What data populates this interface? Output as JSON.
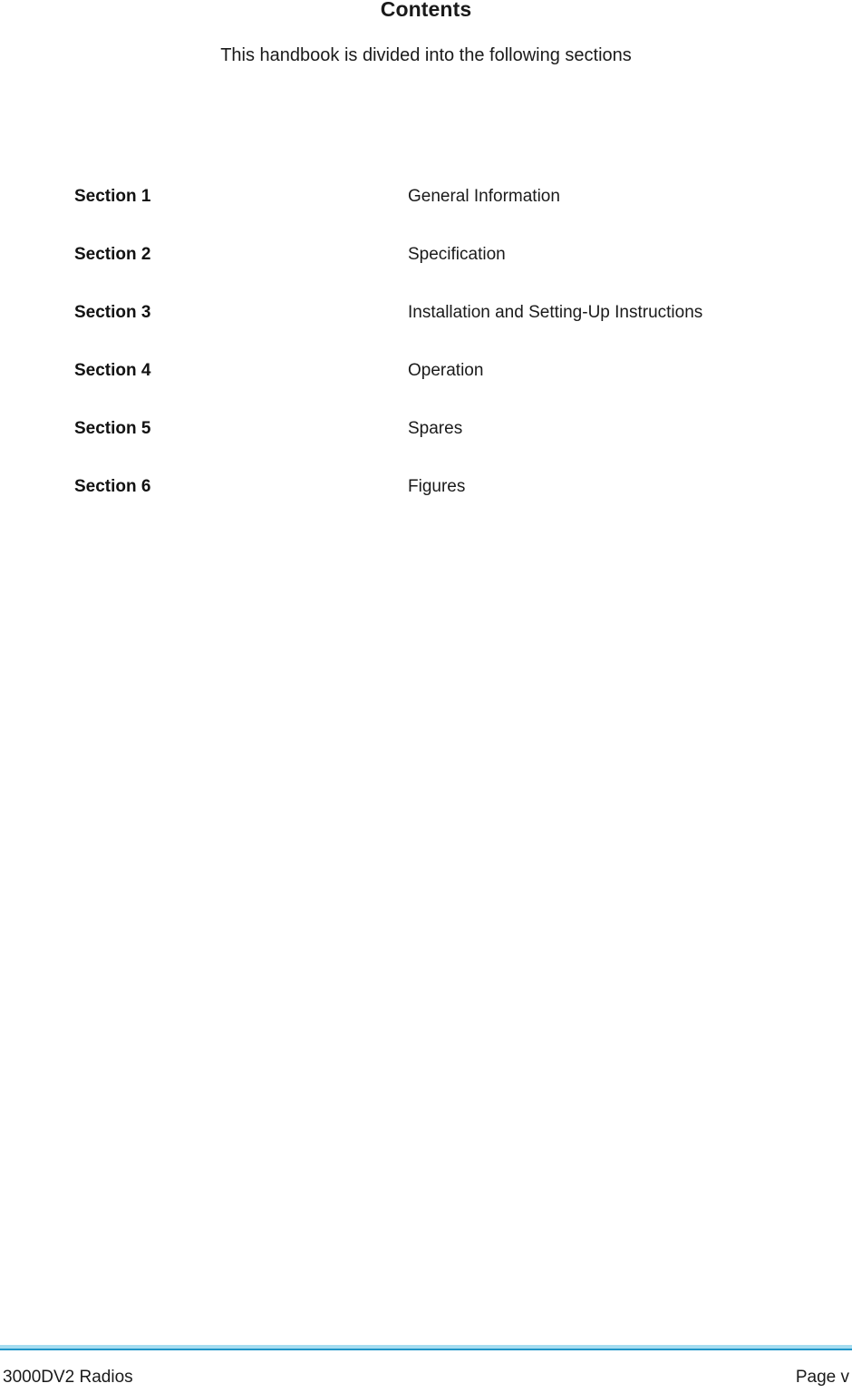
{
  "header": {
    "title": "Contents",
    "subtitle": "This handbook is divided into the following sections"
  },
  "contents": {
    "rows": [
      {
        "label": "Section 1",
        "description": "General Information"
      },
      {
        "label": "Section 2",
        "description": "Specification"
      },
      {
        "label": "Section 3",
        "description": "Installation and Setting-Up Instructions"
      },
      {
        "label": "Section 4",
        "description": "Operation"
      },
      {
        "label": "Section 5",
        "description": "Spares"
      },
      {
        "label": "Section 6",
        "description": "Figures"
      }
    ]
  },
  "footer": {
    "left": "3000DV2 Radios",
    "right": "Page v",
    "rule_color": "#2196c8",
    "rule_highlight_color": "#a5dcf0"
  }
}
